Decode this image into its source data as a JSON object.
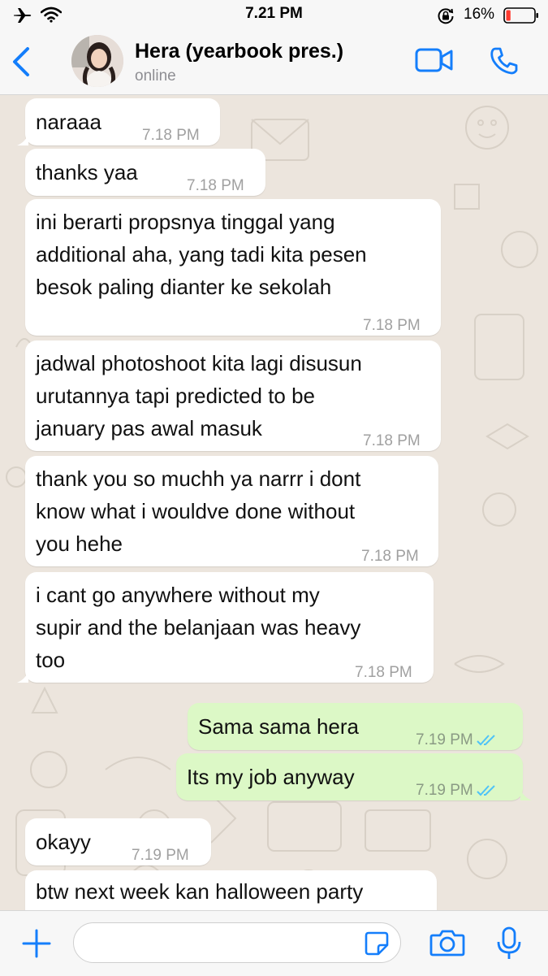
{
  "status_bar": {
    "time": "7.21 PM",
    "battery": "16%",
    "battery_level": 0.16,
    "icons": [
      "airplane-icon",
      "wifi-icon",
      "rotation-lock-icon",
      "battery-icon"
    ]
  },
  "header": {
    "contact_name": "Hera (yearbook pres.)",
    "presence": "online",
    "icons": [
      "chevron-left-icon",
      "avatar",
      "video-call-icon",
      "phone-icon"
    ]
  },
  "messages": [
    {
      "dir": "in",
      "lines": [
        "naraaa"
      ],
      "time": "7.18 PM"
    },
    {
      "dir": "in",
      "lines": [
        "thanks yaa"
      ],
      "time": "7.18 PM"
    },
    {
      "dir": "in",
      "lines": [
        "ini berarti propsnya tinggal yang",
        "additional aha, yang tadi kita pesen",
        "besok paling dianter ke sekolah"
      ],
      "time": "7.18 PM"
    },
    {
      "dir": "in",
      "lines": [
        "jadwal photoshoot kita lagi disusun",
        "urutannya tapi predicted to be",
        "january pas awal masuk"
      ],
      "time": "7.18 PM"
    },
    {
      "dir": "in",
      "lines": [
        "thank you so muchh ya narrr i dont",
        "know what i wouldve done without",
        "you hehe"
      ],
      "time": "7.18 PM"
    },
    {
      "dir": "in",
      "lines": [
        "i cant go anywhere without my",
        "supir and the belanjaan was heavy",
        "too"
      ],
      "time": "7.18 PM"
    },
    {
      "dir": "out",
      "lines": [
        "Sama sama hera"
      ],
      "time": "7.19 PM",
      "status": "read"
    },
    {
      "dir": "out",
      "lines": [
        "Its my job anyway"
      ],
      "time": "7.19 PM",
      "status": "read"
    },
    {
      "dir": "in",
      "lines": [
        "okayy"
      ],
      "time": "7.19 PM"
    },
    {
      "dir": "in",
      "lines": [
        "btw next week kan halloween party"
      ],
      "time": ""
    }
  ],
  "composer": {
    "placeholder": "",
    "icons": [
      "plus-icon",
      "sticker-icon",
      "camera-icon",
      "microphone-icon"
    ]
  },
  "colors": {
    "accent": "#147efb",
    "incoming_bubble": "#ffffff",
    "outgoing_bubble": "#dcf8c6",
    "read_tick": "#4fc3f7",
    "chat_background": "#ece5dd",
    "battery_low": "#ff3b30"
  }
}
